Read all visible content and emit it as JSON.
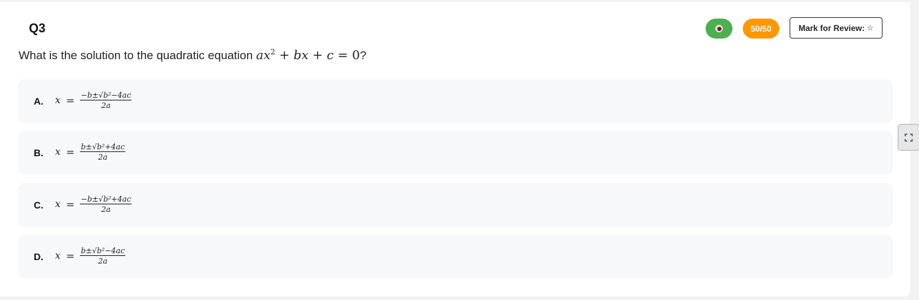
{
  "question": {
    "number": "Q3",
    "text": "What is the solution to the quadratic equation",
    "equation": {
      "a": "a",
      "x": "x",
      "exp": "2",
      "plus1": "+",
      "b": "b",
      "x2": "x",
      "plus2": "+",
      "c": "c",
      "eq": "=",
      "zero": "0"
    },
    "suffix": "?"
  },
  "header": {
    "eye_icon": "eye-icon",
    "score": "50/50",
    "mark_label": "Mark for Review:",
    "mark_icon": "☆"
  },
  "colors": {
    "eye_pill": "#4caf50",
    "score_pill": "#ff9800",
    "option_bg": "#f7f8fa"
  },
  "options": [
    {
      "letter": "A.",
      "lhs": "x",
      "eq": "=",
      "numerator": "−b±√b²−4ac",
      "denominator": "2a"
    },
    {
      "letter": "B.",
      "lhs": "x",
      "eq": "=",
      "numerator": "b±√b²+4ac",
      "denominator": "2a"
    },
    {
      "letter": "C.",
      "lhs": "x",
      "eq": "=",
      "numerator": "−b±√b²+4ac",
      "denominator": "2a"
    },
    {
      "letter": "D.",
      "lhs": "x",
      "eq": "=",
      "numerator": "b±√b²−4ac",
      "denominator": "2a"
    }
  ],
  "side_button_icon": "expand-icon"
}
